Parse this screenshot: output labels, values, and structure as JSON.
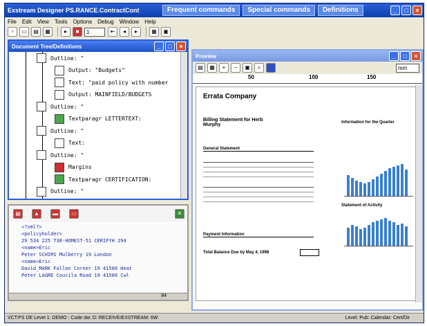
{
  "window": {
    "title": "Exstream Designer PS.RANCE.ContractCont",
    "tabs": [
      "Frequent commands",
      "Special commands",
      "Definitions"
    ]
  },
  "menu": [
    "File",
    "Edit",
    "View",
    "Tools",
    "Options",
    "Debug",
    "Window",
    "Help"
  ],
  "toolbar": {
    "zoom_value": "1"
  },
  "tree_panel": {
    "title": "Document Tree/Definitions",
    "rows": [
      {
        "icon": "page",
        "label": "Outline: \"",
        "indent": 1
      },
      {
        "icon": "page",
        "label": "Output: \"Budgets\"",
        "indent": 2
      },
      {
        "icon": "page",
        "label": "Text: \"paid policy with number",
        "indent": 2
      },
      {
        "icon": "page",
        "label": "Output: MAINFIELD/BUDGETS",
        "indent": 2
      },
      {
        "icon": "page",
        "label": "Outline: \"",
        "indent": 1
      },
      {
        "icon": "green",
        "label": "Textparagr LETTERTEXT:",
        "indent": 2
      },
      {
        "icon": "page",
        "label": "Outline: \"",
        "indent": 1
      },
      {
        "icon": "page",
        "label": "Text:",
        "indent": 2
      },
      {
        "icon": "page",
        "label": "Outline: \"",
        "indent": 1
      },
      {
        "icon": "red",
        "label": "Margins",
        "indent": 2
      },
      {
        "icon": "green",
        "label": "Textparagr CERTIFICATION:",
        "indent": 2
      },
      {
        "icon": "page",
        "label": "Outline: \"",
        "indent": 1
      }
    ]
  },
  "xml_panel": {
    "lines": [
      "<?xml?>",
      "<policyholder>",
      "29 534 225 T38-HOMEST-51 CERIFYH 294",
      "<name>Eric",
      "Peter SCHIRS Mulberry 19 London",
      "<name>Eric",
      "David_MARK Fallen Corner 19 41500 Heat",
      "Peter LAGRE Coucila Road 19 41500 Cwl"
    ],
    "status_value": "84"
  },
  "preview_panel": {
    "title": "Preview",
    "ruler_marks": [
      "50",
      "100",
      "150"
    ],
    "zoom": "mm",
    "doc": {
      "brand": "Errata Company",
      "heading": "Billing Statement for Herb Murphy",
      "sections": [
        "General Statement",
        "Payment Information",
        "Total Balance Due by May 4, 1998"
      ],
      "chart_titles": [
        "Information for the Quarter",
        "Statement of Activity"
      ]
    }
  },
  "statusbar": {
    "left": "VCT:PS DE Level 1: DEMO : Code dw: D: RECEIVE/EXSTREAM: 6W",
    "right": "Level: Pub: Calendar: Cert/Dir"
  },
  "colors": {
    "title_blue": "#2a5fd8",
    "chart_blue": "#3a7fd0"
  }
}
